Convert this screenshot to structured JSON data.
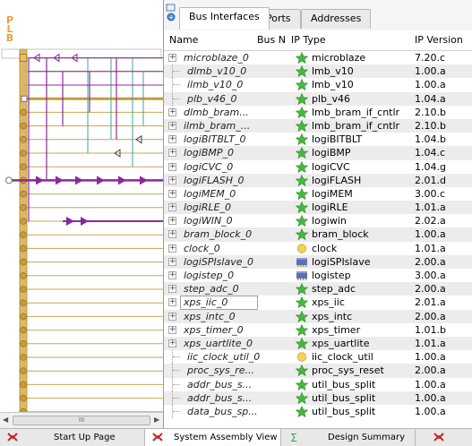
{
  "bus_panel": {
    "label": "PLB",
    "scroll_thumb_glyph": "III"
  },
  "tabs": [
    {
      "label": "Bus Interfaces",
      "active": true
    },
    {
      "label": "Ports",
      "active": false
    },
    {
      "label": "Addresses",
      "active": false
    }
  ],
  "columns": {
    "name": "Name",
    "bus": "Bus N",
    "ip_type": "IP Type",
    "ip_version": "IP Version"
  },
  "rows": [
    {
      "name": "microblaze_0",
      "type": "microblaze",
      "version": "7.20.c",
      "icon": "star-icon",
      "expandable": true
    },
    {
      "name": "dlmb_v10_0",
      "type": "lmb_v10",
      "version": "1.00.a",
      "icon": "star-icon",
      "expandable": false
    },
    {
      "name": "ilmb_v10_0",
      "type": "lmb_v10",
      "version": "1.00.a",
      "icon": "star-icon",
      "expandable": false
    },
    {
      "name": "plb_v46_0",
      "type": "plb_v46",
      "version": "1.04.a",
      "icon": "star-icon",
      "expandable": false
    },
    {
      "name": "dlmb_bram...",
      "type": "lmb_bram_if_cntlr",
      "version": "2.10.b",
      "icon": "star-icon",
      "expandable": true
    },
    {
      "name": "ilmb_bram_...",
      "type": "lmb_bram_if_cntlr",
      "version": "2.10.b",
      "icon": "star-icon",
      "expandable": true
    },
    {
      "name": "logiBITBLT_0",
      "type": "logiBITBLT",
      "version": "1.04.b",
      "icon": "star-icon",
      "expandable": true
    },
    {
      "name": "logiBMP_0",
      "type": "logiBMP",
      "version": "1.04.c",
      "icon": "star-icon",
      "expandable": true
    },
    {
      "name": "logiCVC_0",
      "type": "logiCVC",
      "version": "1.04.g",
      "icon": "star-icon",
      "expandable": true
    },
    {
      "name": "logiFLASH_0",
      "type": "logiFLASH",
      "version": "2.01.d",
      "icon": "star-icon",
      "expandable": true
    },
    {
      "name": "logiMEM_0",
      "type": "logiMEM",
      "version": "3.00.c",
      "icon": "star-icon",
      "expandable": true
    },
    {
      "name": "logiRLE_0",
      "type": "logiRLE",
      "version": "1.01.a",
      "icon": "star-icon",
      "expandable": true
    },
    {
      "name": "logiWIN_0",
      "type": "logiwin",
      "version": "2.02.a",
      "icon": "star-icon",
      "expandable": true
    },
    {
      "name": "bram_block_0",
      "type": "bram_block",
      "version": "1.00.a",
      "icon": "star-icon",
      "expandable": true
    },
    {
      "name": "clock_0",
      "type": "clock",
      "version": "1.01.a",
      "icon": "circle-icon",
      "expandable": true
    },
    {
      "name": "logiSPIslave_0",
      "type": "logiSPIslave",
      "version": "2.00.a",
      "icon": "chip-icon",
      "expandable": true
    },
    {
      "name": "logistep_0",
      "type": "logistep",
      "version": "3.00.a",
      "icon": "chip-icon",
      "expandable": true
    },
    {
      "name": "step_adc_0",
      "type": "step_adc",
      "version": "2.00.a",
      "icon": "star-icon",
      "expandable": true
    },
    {
      "name": "xps_iic_0",
      "type": "xps_iic",
      "version": "2.01.a",
      "icon": "star-icon",
      "expandable": true,
      "editing": true
    },
    {
      "name": "xps_intc_0",
      "type": "xps_intc",
      "version": "2.00.a",
      "icon": "star-icon",
      "expandable": true
    },
    {
      "name": "xps_timer_0",
      "type": "xps_timer",
      "version": "1.01.b",
      "icon": "star-icon",
      "expandable": true
    },
    {
      "name": "xps_uartlite_0",
      "type": "xps_uartlite",
      "version": "1.01.a",
      "icon": "star-icon",
      "expandable": true
    },
    {
      "name": "iic_clock_util_0",
      "type": "iic_clock_util",
      "version": "1.00.a",
      "icon": "circle-icon",
      "expandable": false
    },
    {
      "name": "proc_sys_re...",
      "type": "proc_sys_reset",
      "version": "2.00.a",
      "icon": "star-icon",
      "expandable": false
    },
    {
      "name": "addr_bus_s...",
      "type": "util_bus_split",
      "version": "1.00.a",
      "icon": "star-icon",
      "expandable": false
    },
    {
      "name": "addr_bus_s...",
      "type": "util_bus_split",
      "version": "1.00.a",
      "icon": "star-icon",
      "expandable": false
    },
    {
      "name": "data_bus_sp...",
      "type": "util_bus_split",
      "version": "1.00.a",
      "icon": "star-icon",
      "expandable": false
    }
  ],
  "bottom_tabs": [
    {
      "label": "Start Up Page",
      "icon": "xilinx-icon",
      "active": false
    },
    {
      "label": "System Assembly View",
      "icon": "xilinx-icon",
      "active": true
    },
    {
      "label": "Design Summary",
      "icon": "sigma-icon",
      "active": false
    },
    {
      "label": "",
      "icon": "xilinx-icon",
      "active": false
    }
  ],
  "colors": {
    "plb_bus": "#c89b3c",
    "lmb_bus": "#6b8fb3",
    "connection_purple": "#8a2a9a",
    "connection_teal": "#3aa6a6",
    "star_green": "#47b83f",
    "circle_yellow": "#f3d35a",
    "chip_blue": "#5d6fb5"
  }
}
